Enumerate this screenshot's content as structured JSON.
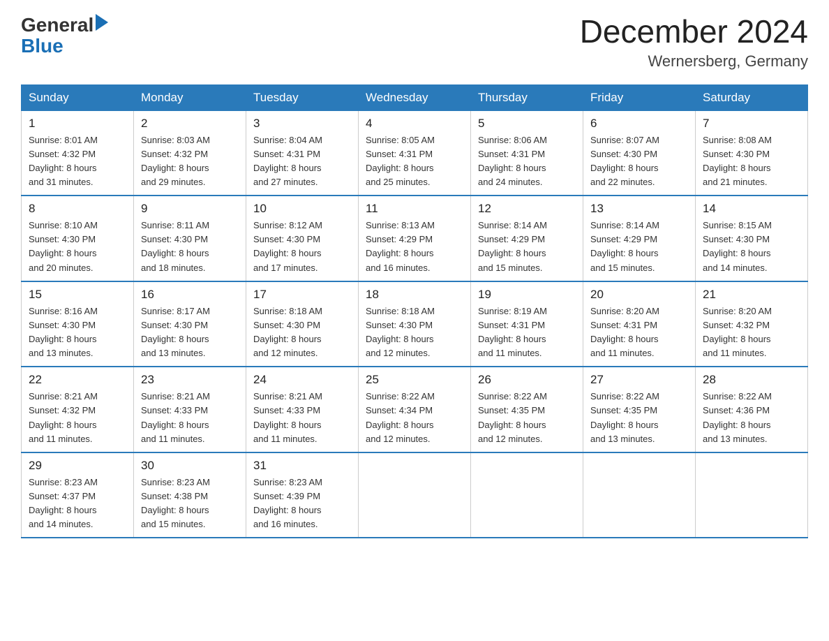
{
  "header": {
    "logo_general": "General",
    "logo_blue": "Blue",
    "month_year": "December 2024",
    "location": "Wernersberg, Germany"
  },
  "days_of_week": [
    "Sunday",
    "Monday",
    "Tuesday",
    "Wednesday",
    "Thursday",
    "Friday",
    "Saturday"
  ],
  "weeks": [
    [
      {
        "day": "1",
        "sunrise": "8:01 AM",
        "sunset": "4:32 PM",
        "daylight": "8 hours and 31 minutes."
      },
      {
        "day": "2",
        "sunrise": "8:03 AM",
        "sunset": "4:32 PM",
        "daylight": "8 hours and 29 minutes."
      },
      {
        "day": "3",
        "sunrise": "8:04 AM",
        "sunset": "4:31 PM",
        "daylight": "8 hours and 27 minutes."
      },
      {
        "day": "4",
        "sunrise": "8:05 AM",
        "sunset": "4:31 PM",
        "daylight": "8 hours and 25 minutes."
      },
      {
        "day": "5",
        "sunrise": "8:06 AM",
        "sunset": "4:31 PM",
        "daylight": "8 hours and 24 minutes."
      },
      {
        "day": "6",
        "sunrise": "8:07 AM",
        "sunset": "4:30 PM",
        "daylight": "8 hours and 22 minutes."
      },
      {
        "day": "7",
        "sunrise": "8:08 AM",
        "sunset": "4:30 PM",
        "daylight": "8 hours and 21 minutes."
      }
    ],
    [
      {
        "day": "8",
        "sunrise": "8:10 AM",
        "sunset": "4:30 PM",
        "daylight": "8 hours and 20 minutes."
      },
      {
        "day": "9",
        "sunrise": "8:11 AM",
        "sunset": "4:30 PM",
        "daylight": "8 hours and 18 minutes."
      },
      {
        "day": "10",
        "sunrise": "8:12 AM",
        "sunset": "4:30 PM",
        "daylight": "8 hours and 17 minutes."
      },
      {
        "day": "11",
        "sunrise": "8:13 AM",
        "sunset": "4:29 PM",
        "daylight": "8 hours and 16 minutes."
      },
      {
        "day": "12",
        "sunrise": "8:14 AM",
        "sunset": "4:29 PM",
        "daylight": "8 hours and 15 minutes."
      },
      {
        "day": "13",
        "sunrise": "8:14 AM",
        "sunset": "4:29 PM",
        "daylight": "8 hours and 15 minutes."
      },
      {
        "day": "14",
        "sunrise": "8:15 AM",
        "sunset": "4:30 PM",
        "daylight": "8 hours and 14 minutes."
      }
    ],
    [
      {
        "day": "15",
        "sunrise": "8:16 AM",
        "sunset": "4:30 PM",
        "daylight": "8 hours and 13 minutes."
      },
      {
        "day": "16",
        "sunrise": "8:17 AM",
        "sunset": "4:30 PM",
        "daylight": "8 hours and 13 minutes."
      },
      {
        "day": "17",
        "sunrise": "8:18 AM",
        "sunset": "4:30 PM",
        "daylight": "8 hours and 12 minutes."
      },
      {
        "day": "18",
        "sunrise": "8:18 AM",
        "sunset": "4:30 PM",
        "daylight": "8 hours and 12 minutes."
      },
      {
        "day": "19",
        "sunrise": "8:19 AM",
        "sunset": "4:31 PM",
        "daylight": "8 hours and 11 minutes."
      },
      {
        "day": "20",
        "sunrise": "8:20 AM",
        "sunset": "4:31 PM",
        "daylight": "8 hours and 11 minutes."
      },
      {
        "day": "21",
        "sunrise": "8:20 AM",
        "sunset": "4:32 PM",
        "daylight": "8 hours and 11 minutes."
      }
    ],
    [
      {
        "day": "22",
        "sunrise": "8:21 AM",
        "sunset": "4:32 PM",
        "daylight": "8 hours and 11 minutes."
      },
      {
        "day": "23",
        "sunrise": "8:21 AM",
        "sunset": "4:33 PM",
        "daylight": "8 hours and 11 minutes."
      },
      {
        "day": "24",
        "sunrise": "8:21 AM",
        "sunset": "4:33 PM",
        "daylight": "8 hours and 11 minutes."
      },
      {
        "day": "25",
        "sunrise": "8:22 AM",
        "sunset": "4:34 PM",
        "daylight": "8 hours and 12 minutes."
      },
      {
        "day": "26",
        "sunrise": "8:22 AM",
        "sunset": "4:35 PM",
        "daylight": "8 hours and 12 minutes."
      },
      {
        "day": "27",
        "sunrise": "8:22 AM",
        "sunset": "4:35 PM",
        "daylight": "8 hours and 13 minutes."
      },
      {
        "day": "28",
        "sunrise": "8:22 AM",
        "sunset": "4:36 PM",
        "daylight": "8 hours and 13 minutes."
      }
    ],
    [
      {
        "day": "29",
        "sunrise": "8:23 AM",
        "sunset": "4:37 PM",
        "daylight": "8 hours and 14 minutes."
      },
      {
        "day": "30",
        "sunrise": "8:23 AM",
        "sunset": "4:38 PM",
        "daylight": "8 hours and 15 minutes."
      },
      {
        "day": "31",
        "sunrise": "8:23 AM",
        "sunset": "4:39 PM",
        "daylight": "8 hours and 16 minutes."
      },
      null,
      null,
      null,
      null
    ]
  ],
  "labels": {
    "sunrise": "Sunrise:",
    "sunset": "Sunset:",
    "daylight": "Daylight:"
  }
}
